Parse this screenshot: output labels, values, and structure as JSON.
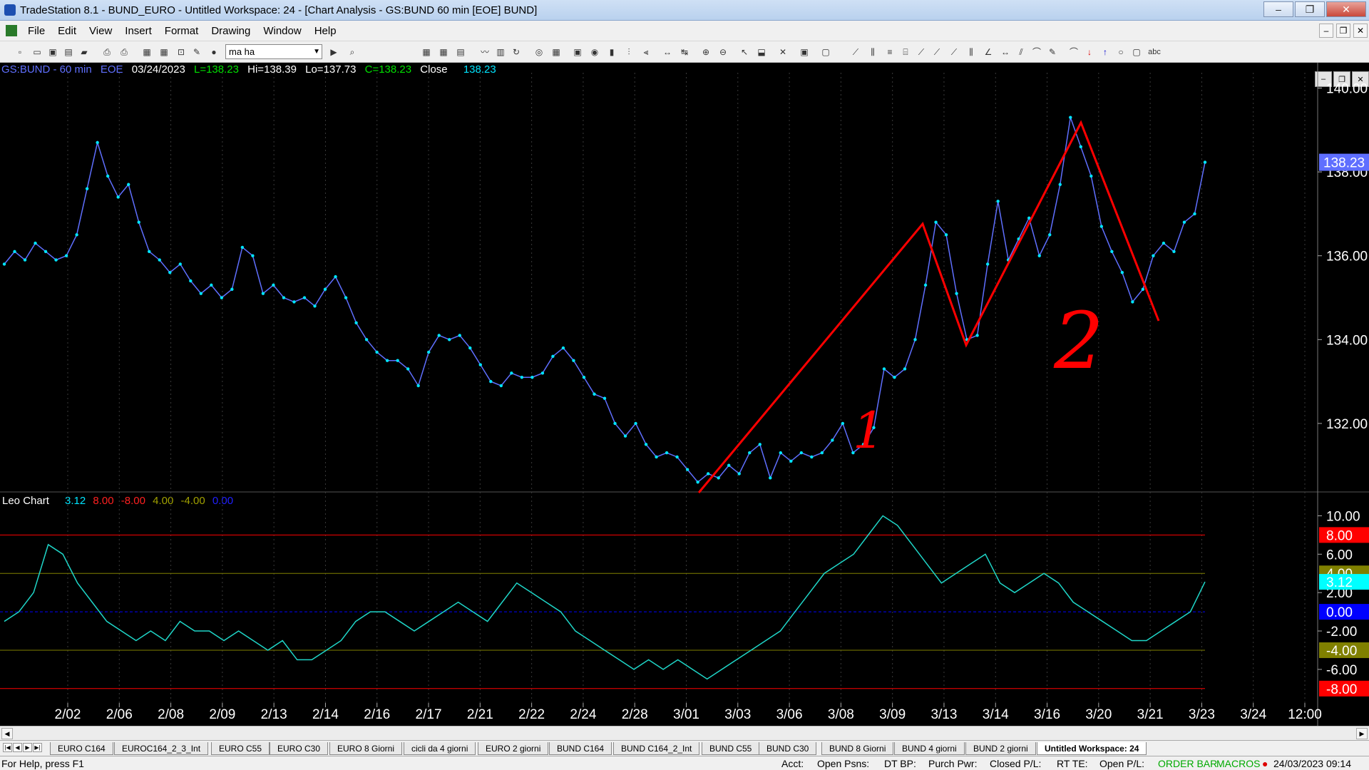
{
  "window": {
    "title": "TradeStation 8.1 - BUND_EURO - Untitled Workspace:  24 - [Chart Analysis - GS:BUND  60 min  [EOE] BUND]",
    "minimize": "–",
    "restore": "❐",
    "close": "✕"
  },
  "menu": [
    "File",
    "Edit",
    "View",
    "Insert",
    "Format",
    "Drawing",
    "Window",
    "Help"
  ],
  "toolbar": {
    "combo_value": "ma ha"
  },
  "chart_header": {
    "symbol": "GS:BUND - 60 min",
    "feed": "EOE",
    "date": "03/24/2023",
    "last": "L=138.23",
    "high": "Hi=138.39",
    "low": "Lo=137.73",
    "close": "C=138.23",
    "close_label": "Close",
    "close_value": "138.23"
  },
  "indicator_header": {
    "name": "Leo Chart",
    "values": [
      "3.12",
      "8.00",
      "-8.00",
      "4.00",
      "-4.00",
      "0.00"
    ]
  },
  "colors": {
    "price": "#5f6fff",
    "close": "#00e5ff",
    "annotation": "#ff0000",
    "osc": "#1fd6c8",
    "band8": "#ff0000",
    "band4": "#808000",
    "zero": "#0000ff"
  },
  "price_axis": {
    "labels": [
      "140.00",
      "138.00",
      "136.00",
      "134.00",
      "132.00"
    ],
    "last_badge": "138.23"
  },
  "osc_axis": {
    "labels": [
      "10.00",
      "6.00",
      "2.00",
      "-2.00",
      "-6.00"
    ],
    "badges": [
      "8.00",
      "4.00",
      "3.12",
      "0.00",
      "-4.00",
      "-8.00"
    ]
  },
  "dates": [
    "2/02",
    "2/06",
    "2/08",
    "2/09",
    "2/13",
    "2/14",
    "2/16",
    "2/17",
    "2/21",
    "2/22",
    "2/24",
    "2/28",
    "3/01",
    "3/03",
    "3/06",
    "3/08",
    "3/09",
    "3/13",
    "3/14",
    "3/16",
    "3/20",
    "3/21",
    "3/23",
    "3/24",
    "12:00"
  ],
  "annotations": {
    "label1": "1",
    "label2": "2"
  },
  "chart_data": {
    "type": "line",
    "series": [
      {
        "values": [
          135.8,
          136.1,
          135.9,
          136.3,
          136.1,
          135.9,
          136.0,
          136.5,
          137.6,
          138.7,
          137.9,
          137.4,
          137.7,
          136.8,
          136.1,
          135.9,
          135.6,
          135.8,
          135.4,
          135.1,
          135.3,
          135.0,
          135.2,
          136.2,
          136.0,
          135.1,
          135.3,
          135.0,
          134.9,
          135.0,
          134.8,
          135.2,
          135.5,
          135.0,
          134.4,
          134.0,
          133.7,
          133.5,
          133.5,
          133.3,
          132.9,
          133.7,
          134.1,
          134.0,
          134.1,
          133.8,
          133.4,
          133.0,
          132.9,
          133.2,
          133.1,
          133.1,
          133.2,
          133.6,
          133.8,
          133.5,
          133.1,
          132.7,
          132.6,
          132.0,
          131.7,
          132.0,
          131.5,
          131.2,
          131.3,
          131.2,
          130.9,
          130.6,
          130.8,
          130.7,
          131.0,
          130.8,
          131.3,
          131.5,
          130.7,
          131.3,
          131.1,
          131.3,
          131.2,
          131.3,
          131.6,
          132.0,
          131.3,
          131.5,
          131.9,
          133.3,
          133.1,
          133.3,
          134.0,
          135.3,
          136.8,
          136.5,
          135.1,
          134.0,
          134.1,
          135.8,
          137.3,
          135.9,
          136.4,
          136.9,
          136.0,
          136.5,
          137.7,
          139.3,
          138.6,
          137.9,
          136.7,
          136.1,
          135.6,
          134.9,
          135.2,
          136.0,
          136.3,
          136.1,
          136.8,
          137.0,
          138.23
        ]
      }
    ],
    "y_range": [
      130.4,
      140.4
    ],
    "secondary": {
      "name": "Leo Chart",
      "values": [
        -1,
        0,
        2,
        7,
        6,
        3,
        1,
        -1,
        -2,
        -3,
        -2,
        -3,
        -1,
        -2,
        -2,
        -3,
        -2,
        -3,
        -4,
        -3,
        -5,
        -5,
        -4,
        -3,
        -1,
        0,
        0,
        -1,
        -2,
        -1,
        0,
        1,
        0,
        -1,
        1,
        3,
        2,
        1,
        0,
        -2,
        -3,
        -4,
        -5,
        -6,
        -5,
        -6,
        -5,
        -6,
        -7,
        -6,
        -5,
        -4,
        -3,
        -2,
        0,
        2,
        4,
        5,
        6,
        8,
        10,
        9,
        7,
        5,
        3,
        4,
        5,
        6,
        3,
        2,
        3,
        4,
        3,
        1,
        0,
        -1,
        -2,
        -3,
        -3,
        -2,
        -1,
        0,
        3.12
      ],
      "y_range": [
        -9.5,
        11
      ],
      "bands": [
        8,
        4,
        0,
        -4,
        -8
      ]
    }
  }
}
